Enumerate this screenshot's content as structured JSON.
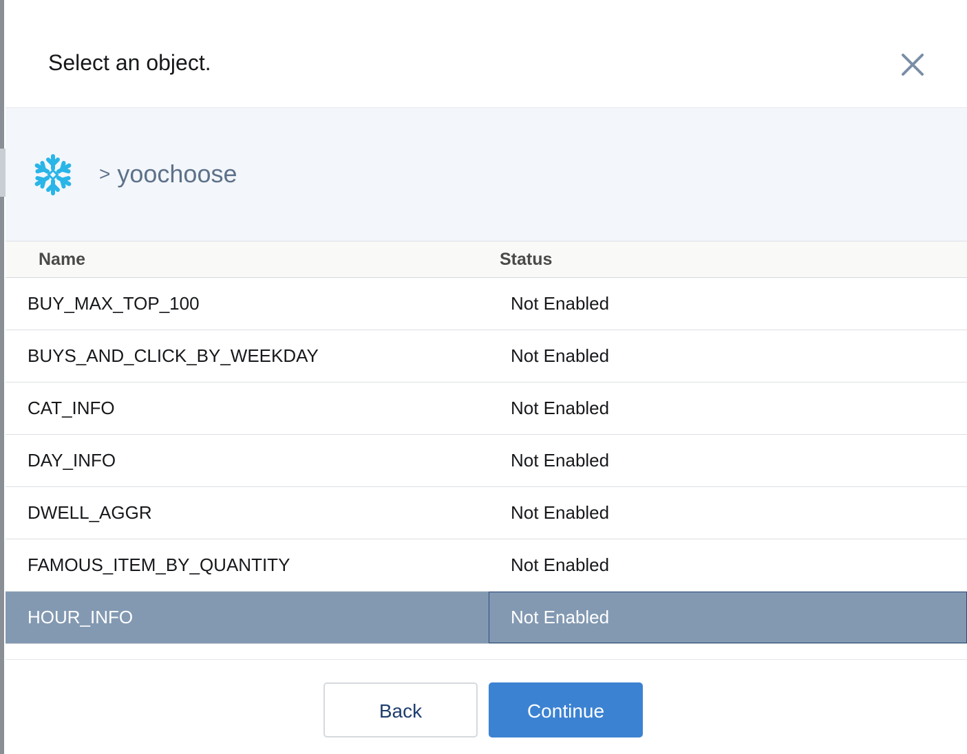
{
  "dialog": {
    "title": "Select an object."
  },
  "breadcrumb": {
    "separator": ">",
    "current": "yoochoose"
  },
  "table": {
    "columns": {
      "name": "Name",
      "status": "Status"
    },
    "rows": [
      {
        "name": "BUY_MAX_TOP_100",
        "status": "Not Enabled"
      },
      {
        "name": "BUYS_AND_CLICK_BY_WEEKDAY",
        "status": "Not Enabled"
      },
      {
        "name": "CAT_INFO",
        "status": "Not Enabled"
      },
      {
        "name": "DAY_INFO",
        "status": "Not Enabled"
      },
      {
        "name": "DWELL_AGGR",
        "status": "Not Enabled"
      },
      {
        "name": "FAMOUS_ITEM_BY_QUANTITY",
        "status": "Not Enabled"
      },
      {
        "name": "HOUR_INFO",
        "status": "Not Enabled"
      }
    ],
    "selected_row": "HOUR_INFO"
  },
  "footer": {
    "back_label": "Back",
    "continue_label": "Continue"
  },
  "icons": {
    "close": "close-icon",
    "source": "snowflake-logo"
  },
  "colors": {
    "accent": "#3c82d2",
    "selected_row": "#8399b2",
    "snowflake": "#29b5e8"
  }
}
